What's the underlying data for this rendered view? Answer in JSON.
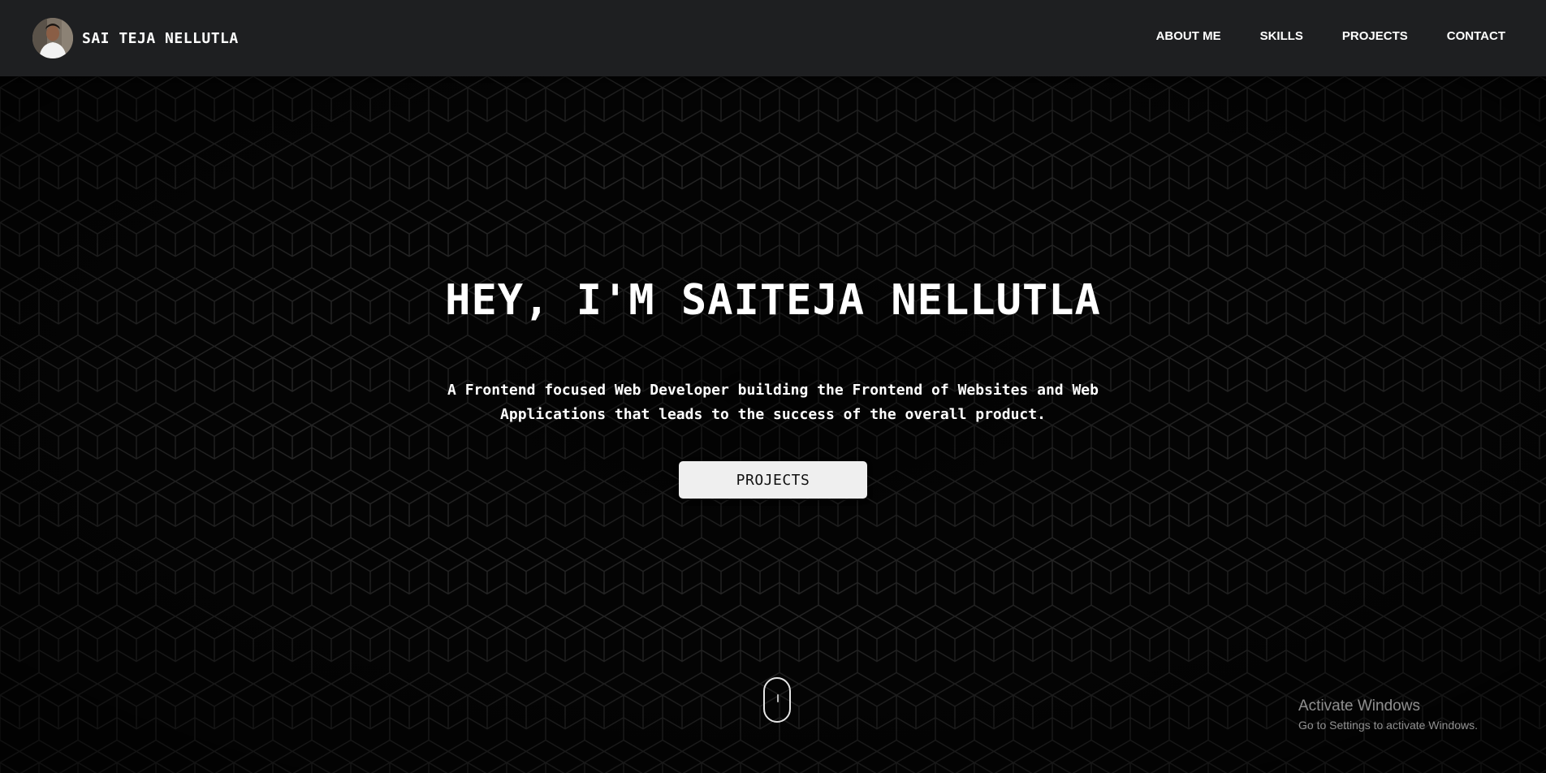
{
  "header": {
    "brand_name": "SAI TEJA NELLUTLA",
    "nav_items": [
      {
        "label": "ABOUT ME"
      },
      {
        "label": "SKILLS"
      },
      {
        "label": "PROJECTS"
      },
      {
        "label": "CONTACT"
      }
    ]
  },
  "hero": {
    "title": "HEY, I'M SAITEJA NELLUTLA",
    "subtitle": "A Frontend focused Web Developer building the Frontend of Websites and Web Applications that leads to the success of the overall product.",
    "button_label": "PROJECTS"
  },
  "os_watermark": {
    "title": "Activate Windows",
    "subtitle": "Go to Settings to activate Windows."
  },
  "colors": {
    "header_bg": "#1e1f21",
    "hero_bg": "#000000",
    "button_bg": "#efefef",
    "text": "#ffffff"
  }
}
